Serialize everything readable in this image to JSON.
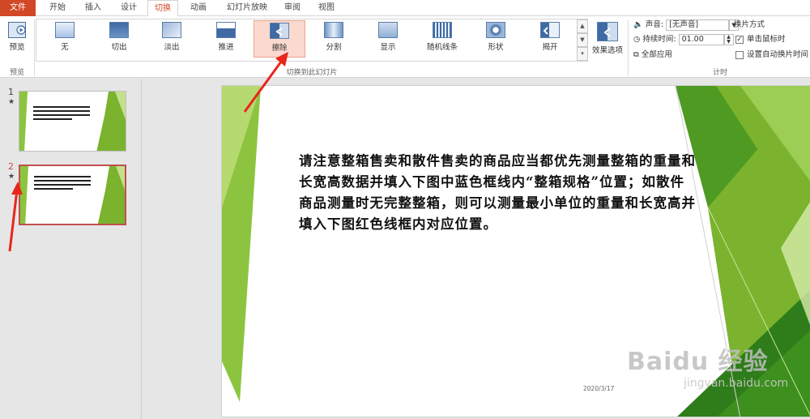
{
  "tabs": [
    "文件",
    "开始",
    "插入",
    "设计",
    "切换",
    "动画",
    "幻灯片放映",
    "审阅",
    "视图"
  ],
  "preview": {
    "label": "预览",
    "group_label": "预览"
  },
  "transitions": [
    {
      "label": "无"
    },
    {
      "label": "切出"
    },
    {
      "label": "淡出"
    },
    {
      "label": "推进"
    },
    {
      "label": "擦除",
      "selected": true
    },
    {
      "label": "分割"
    },
    {
      "label": "显示"
    },
    {
      "label": "随机线条"
    },
    {
      "label": "形状"
    },
    {
      "label": "揭开"
    }
  ],
  "transitions_group_label": "切换到此幻灯片",
  "effect_options_label": "效果选项",
  "timing": {
    "sound_label": "声音:",
    "sound_value": "[无声音]",
    "duration_label": "持续时间:",
    "duration_value": "01.00",
    "apply_all_label": "全部应用",
    "advance_title": "换片方式",
    "on_click_label": "单击鼠标时",
    "on_click_checked": true,
    "auto_label": "设置自动换片时间",
    "auto_checked": false,
    "group_label": "计时"
  },
  "thumbnails": [
    {
      "number": "1",
      "star": "★"
    },
    {
      "number": "2",
      "star": "★",
      "selected": true
    }
  ],
  "slide": {
    "text": "请注意整箱售卖和散件售卖的商品应当都优先测量整箱的重量和长宽高数据并填入下图中蓝色框线内“整箱规格”位置；如散件商品测量时无完整整箱，则可以测量最小单位的重量和长宽高并填入下图红色线框内对应位置。",
    "date": "2020/3/17"
  },
  "watermark": {
    "main": "Baidu 经验",
    "sub": "jingyan.baidu.com"
  },
  "colors": {
    "accent": "#d24726",
    "annotation_arrow": "#e8261c",
    "green_dark": "#7bb32e",
    "green_light": "#c5e08c",
    "selected_btn": "#fbd9cf"
  }
}
